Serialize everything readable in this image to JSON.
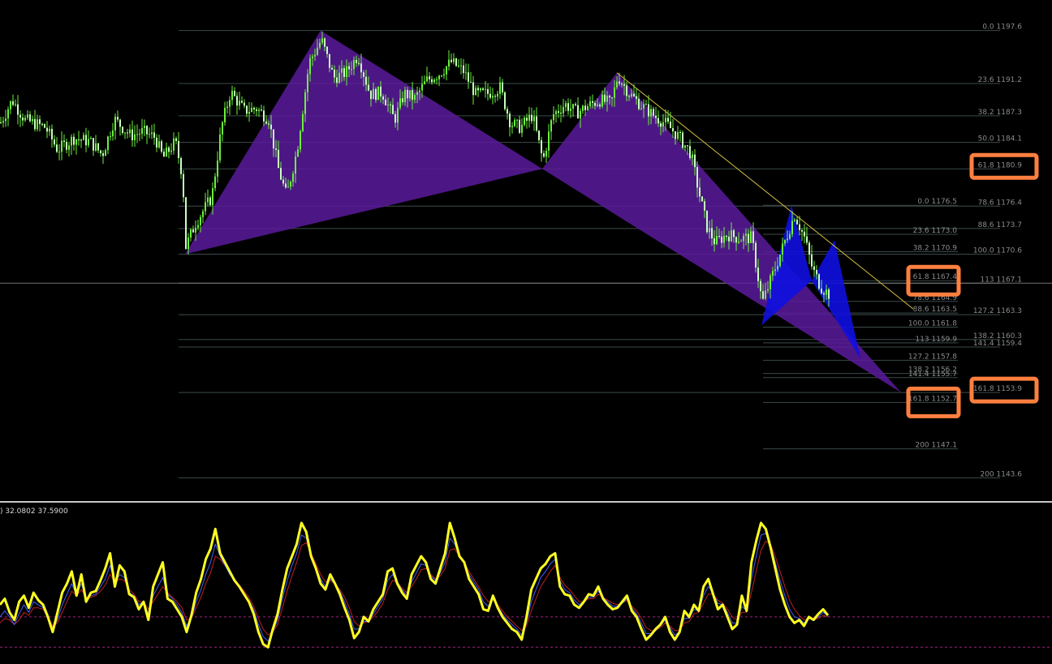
{
  "colors": {
    "background": "#000000",
    "bull_candle": "#6cf03c",
    "bear_candle": "#c8ffc0",
    "pattern_fill": "#5a1a9c",
    "blue_pattern": "#1010e0",
    "fib_line": "#3c4a4a",
    "fib_text": "#8a8a8a",
    "highlight": "#ff7f3f",
    "trend_line": "#d8c040",
    "osc_main": "#ffff22",
    "osc_signal_1": "#4060ff",
    "osc_signal_2": "#c02020",
    "osc_level": "#a02080",
    "separator": "#c8c8c8",
    "current_price": "#a0a0a0"
  },
  "indicator": {
    "label": ") 32.0802 37.5900"
  },
  "chart_data": [
    {
      "type": "candlestick",
      "title": "",
      "ylim": [
        1140.9,
        1200.5
      ],
      "current_price": 1167.1,
      "fib_levels_main": [
        {
          "label": "0.0",
          "price": "1197.6"
        },
        {
          "label": "23.6",
          "price": "1191.2"
        },
        {
          "label": "38.2",
          "price": "1187.3"
        },
        {
          "label": "50.0",
          "price": "1184.1"
        },
        {
          "label": "61.8",
          "price": "1180.9",
          "highlight": true
        },
        {
          "label": "78.6",
          "price": "1176.4"
        },
        {
          "label": "88.6",
          "price": "1173.7"
        },
        {
          "label": "100.0",
          "price": "1170.6"
        },
        {
          "label": "113",
          "price": "1167.1"
        },
        {
          "label": "127.2",
          "price": "1163.3"
        },
        {
          "label": "138.2",
          "price": "1160.3"
        },
        {
          "label": "141.4",
          "price": "1159.4"
        },
        {
          "label": "161.8",
          "price": "1153.9",
          "highlight": true
        },
        {
          "label": "200",
          "price": "1143.6"
        }
      ],
      "fib_levels_secondary": [
        {
          "label": "0.0",
          "price": "1176.5"
        },
        {
          "label": "23.6",
          "price": "1173.0"
        },
        {
          "label": "38.2",
          "price": "1170.9"
        },
        {
          "label": "61.8",
          "price": "1167.4",
          "highlight": true
        },
        {
          "label": "78.6",
          "price": "1164.9"
        },
        {
          "label": "88.6",
          "price": "1163.5"
        },
        {
          "label": "100.0",
          "price": "1161.8"
        },
        {
          "label": "113",
          "price": "1159.9"
        },
        {
          "label": "127.2",
          "price": "1157.8"
        },
        {
          "label": "138.2",
          "price": "1156.2"
        },
        {
          "label": "141.4",
          "price": "1155.7"
        },
        {
          "label": "161.8",
          "price": "1152.7",
          "highlight": true
        },
        {
          "label": "200",
          "price": "1147.1"
        }
      ],
      "pattern_points": [
        {
          "bar": 228,
          "price": 1170.6
        },
        {
          "bar": 395,
          "price": 1197.6
        },
        {
          "bar": 668,
          "price": 1180.9
        },
        {
          "bar": 760,
          "price": 1192.5
        },
        {
          "bar": 1110,
          "price": 1153.9
        }
      ],
      "blue_pattern_points": [
        {
          "bar": 938,
          "price": 1162.0
        },
        {
          "bar": 975,
          "price": 1176.5
        },
        {
          "bar": 1000,
          "price": 1167.4
        },
        {
          "bar": 1028,
          "price": 1172.3
        },
        {
          "bar": 1060,
          "price": 1158.0
        }
      ],
      "trend_line": [
        {
          "bar": 760,
          "price": 1192.5
        },
        {
          "bar": 1125,
          "price": 1164.0
        }
      ],
      "price_path": [
        [
          0,
          1186.5
        ],
        [
          14,
          1189.2
        ],
        [
          30,
          1186.8
        ],
        [
          55,
          1185.9
        ],
        [
          70,
          1183.2
        ],
        [
          90,
          1184.6
        ],
        [
          110,
          1184.2
        ],
        [
          125,
          1182.6
        ],
        [
          140,
          1186.9
        ],
        [
          160,
          1184.9
        ],
        [
          175,
          1185.4
        ],
        [
          190,
          1184.7
        ],
        [
          200,
          1182.2
        ],
        [
          215,
          1184.2
        ],
        [
          224,
          1180.0
        ],
        [
          228,
          1171.5
        ],
        [
          240,
          1174.4
        ],
        [
          260,
          1177.5
        ],
        [
          272,
          1186.0
        ],
        [
          283,
          1190.2
        ],
        [
          300,
          1187.9
        ],
        [
          315,
          1188.2
        ],
        [
          330,
          1186.9
        ],
        [
          342,
          1180.9
        ],
        [
          352,
          1177.6
        ],
        [
          365,
          1183.2
        ],
        [
          380,
          1193.8
        ],
        [
          395,
          1196.5
        ],
        [
          410,
          1191.9
        ],
        [
          425,
          1192.5
        ],
        [
          440,
          1194.6
        ],
        [
          455,
          1189.9
        ],
        [
          470,
          1190.1
        ],
        [
          485,
          1186.8
        ],
        [
          497,
          1190.0
        ],
        [
          510,
          1189.4
        ],
        [
          525,
          1191.6
        ],
        [
          540,
          1192.4
        ],
        [
          555,
          1193.8
        ],
        [
          570,
          1192.7
        ],
        [
          585,
          1189.9
        ],
        [
          600,
          1190.0
        ],
        [
          615,
          1190.7
        ],
        [
          628,
          1186.4
        ],
        [
          640,
          1185.9
        ],
        [
          655,
          1187.4
        ],
        [
          668,
          1181.8
        ],
        [
          680,
          1187.4
        ],
        [
          695,
          1188.7
        ],
        [
          710,
          1187.7
        ],
        [
          725,
          1188.6
        ],
        [
          738,
          1189.2
        ],
        [
          752,
          1188.8
        ],
        [
          760,
          1192.1
        ],
        [
          775,
          1189.9
        ],
        [
          790,
          1188.5
        ],
        [
          805,
          1187.3
        ],
        [
          820,
          1186.3
        ],
        [
          835,
          1184.8
        ],
        [
          850,
          1182.8
        ],
        [
          860,
          1178.1
        ],
        [
          870,
          1173.9
        ],
        [
          880,
          1172.0
        ],
        [
          895,
          1173.0
        ],
        [
          910,
          1172.5
        ],
        [
          925,
          1172.6
        ],
        [
          938,
          1164.7
        ],
        [
          950,
          1167.9
        ],
        [
          965,
          1171.9
        ],
        [
          978,
          1175.4
        ],
        [
          990,
          1172.6
        ],
        [
          1000,
          1168.8
        ],
        [
          1010,
          1166.7
        ],
        [
          1020,
          1165.8
        ]
      ]
    },
    {
      "type": "line",
      "title": ") 32.0802 37.5900",
      "ylim": [
        0,
        100
      ],
      "levels": [
        30,
        10
      ],
      "series": [
        {
          "values": [
            38,
            42,
            33,
            28,
            40,
            44,
            36,
            46,
            41,
            38,
            30,
            20,
            33,
            46,
            52,
            60,
            44,
            58,
            40,
            46,
            47,
            54,
            62,
            72,
            50,
            64,
            60,
            45,
            43,
            35,
            40,
            28,
            50,
            58,
            66,
            42,
            40,
            35,
            30,
            20,
            31,
            46,
            55,
            68,
            75,
            88,
            72,
            66,
            60,
            54,
            50,
            45,
            40,
            32,
            20,
            12,
            10,
            22,
            32,
            48,
            62,
            70,
            78,
            92,
            86,
            70,
            62,
            52,
            48,
            58,
            52,
            45,
            36,
            28,
            16,
            20,
            30,
            27,
            35,
            40,
            45,
            60,
            62,
            52,
            46,
            42,
            58,
            64,
            70,
            66,
            55,
            52,
            62,
            72,
            92,
            82,
            70,
            66,
            55,
            50,
            45,
            35,
            34,
            44,
            36,
            30,
            26,
            22,
            20,
            15,
            30,
            48,
            55,
            62,
            65,
            70,
            72,
            50,
            45,
            44,
            38,
            36,
            40,
            45,
            44,
            50,
            42,
            38,
            35,
            36,
            40,
            44,
            34,
            30,
            22,
            15,
            18,
            22,
            25,
            30,
            20,
            15,
            20,
            34,
            30,
            38,
            34,
            50,
            55,
            45,
            35,
            38,
            30,
            22,
            25,
            44,
            34,
            66,
            80,
            92,
            88,
            76,
            62,
            48,
            38,
            30,
            26,
            28,
            24,
            30,
            28,
            32,
            35,
            31
          ]
        },
        {
          "values": [
            30,
            34,
            30,
            25,
            32,
            38,
            33,
            40,
            38,
            36,
            29,
            22,
            28,
            38,
            45,
            52,
            44,
            52,
            42,
            44,
            45,
            50,
            55,
            64,
            52,
            58,
            56,
            46,
            44,
            38,
            40,
            32,
            44,
            50,
            56,
            45,
            42,
            38,
            33,
            24,
            29,
            40,
            48,
            58,
            66,
            78,
            70,
            64,
            58,
            54,
            50,
            46,
            41,
            35,
            25,
            17,
            14,
            20,
            28,
            42,
            54,
            64,
            72,
            84,
            82,
            70,
            63,
            55,
            50,
            55,
            52,
            47,
            40,
            32,
            22,
            22,
            27,
            27,
            32,
            37,
            42,
            54,
            58,
            53,
            48,
            44,
            53,
            59,
            65,
            64,
            57,
            54,
            59,
            66,
            82,
            78,
            70,
            66,
            58,
            53,
            48,
            40,
            37,
            42,
            37,
            32,
            28,
            25,
            22,
            18,
            26,
            40,
            48,
            56,
            60,
            65,
            68,
            54,
            48,
            46,
            41,
            38,
            40,
            43,
            43,
            47,
            43,
            40,
            37,
            37,
            39,
            42,
            36,
            32,
            26,
            19,
            19,
            21,
            24,
            28,
            23,
            18,
            20,
            29,
            29,
            35,
            34,
            44,
            50,
            46,
            39,
            38,
            33,
            26,
            26,
            37,
            34,
            55,
            70,
            84,
            85,
            78,
            66,
            54,
            44,
            35,
            30,
            29,
            26,
            29,
            28,
            30,
            33,
            31
          ]
        },
        {
          "values": [
            26,
            29,
            28,
            25,
            28,
            33,
            31,
            36,
            36,
            35,
            30,
            24,
            26,
            33,
            40,
            47,
            44,
            48,
            43,
            43,
            44,
            47,
            51,
            58,
            53,
            55,
            54,
            48,
            45,
            40,
            40,
            35,
            40,
            45,
            50,
            46,
            43,
            40,
            36,
            28,
            29,
            36,
            43,
            52,
            59,
            70,
            68,
            64,
            59,
            55,
            51,
            47,
            43,
            37,
            29,
            22,
            18,
            20,
            25,
            36,
            47,
            57,
            66,
            77,
            79,
            72,
            65,
            58,
            53,
            54,
            52,
            48,
            43,
            36,
            27,
            24,
            26,
            27,
            30,
            34,
            39,
            48,
            54,
            53,
            49,
            46,
            50,
            55,
            61,
            62,
            58,
            55,
            57,
            62,
            74,
            75,
            70,
            66,
            60,
            55,
            50,
            44,
            40,
            41,
            38,
            34,
            30,
            27,
            24,
            21,
            24,
            34,
            42,
            50,
            55,
            60,
            64,
            56,
            51,
            48,
            44,
            40,
            40,
            42,
            42,
            45,
            43,
            41,
            39,
            38,
            39,
            41,
            37,
            34,
            29,
            23,
            21,
            21,
            23,
            26,
            24,
            21,
            21,
            26,
            27,
            32,
            33,
            39,
            45,
            45,
            41,
            39,
            35,
            30,
            28,
            33,
            33,
            46,
            60,
            74,
            80,
            78,
            70,
            60,
            50,
            41,
            35,
            31,
            28,
            29,
            28,
            29,
            31,
            30
          ]
        }
      ]
    }
  ]
}
